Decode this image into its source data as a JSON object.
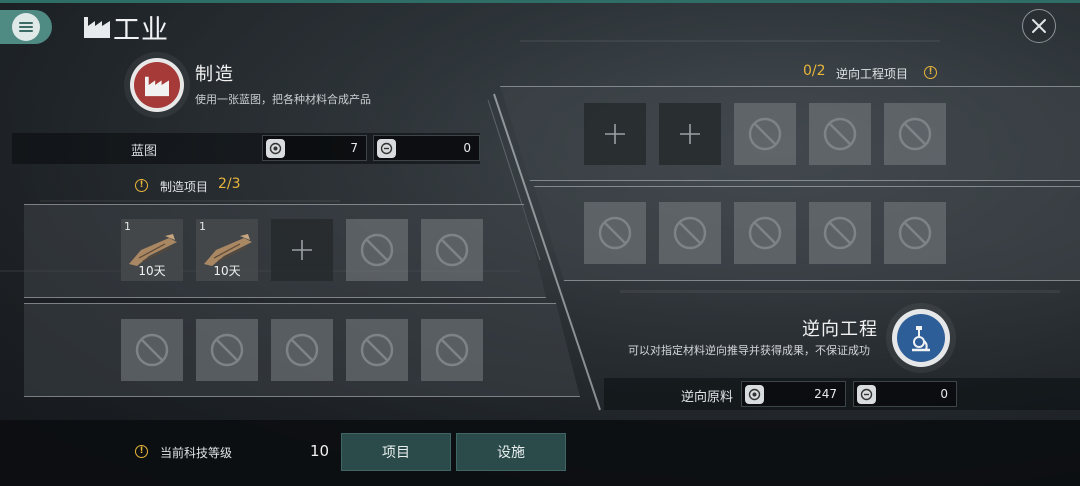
{
  "colors": {
    "accent_teal": "#4f8a83",
    "warning_gold": "#e8b53a",
    "manufacture_red": "#a53a38",
    "reverse_blue": "#2e5e97"
  },
  "header": {
    "title": "工业",
    "title_icon": "factory-icon",
    "menu_icon": "menu-icon",
    "close_icon": "close-icon"
  },
  "manufacture": {
    "title": "制造",
    "description": "使用一张蓝图，把各种材料合成产品",
    "icon": "factory-icon",
    "blueprint": {
      "label": "蓝图",
      "resource_a": {
        "icon": "blueprint-token-icon",
        "value": "7"
      },
      "resource_b": {
        "icon": "blueprint-token-alt-icon",
        "value": "0"
      }
    },
    "projects_label": "制造项目",
    "projects_count": "2/3",
    "slots": [
      {
        "state": "item",
        "qty": "1",
        "duration": "10天"
      },
      {
        "state": "item",
        "qty": "1",
        "duration": "10天"
      },
      {
        "state": "add"
      },
      {
        "state": "locked"
      },
      {
        "state": "locked"
      },
      {
        "state": "locked"
      },
      {
        "state": "locked"
      },
      {
        "state": "locked"
      },
      {
        "state": "locked"
      },
      {
        "state": "locked"
      }
    ]
  },
  "reverse": {
    "projects_count": "0/2",
    "projects_label": "逆向工程项目",
    "title": "逆向工程",
    "description": "可以对指定材料逆向推导并获得成果，不保证成功",
    "icon": "microscope-icon",
    "material": {
      "label": "逆向原料",
      "resource_a": {
        "icon": "material-token-icon",
        "value": "247"
      },
      "resource_b": {
        "icon": "material-token-alt-icon",
        "value": "0"
      }
    },
    "slots": [
      {
        "state": "add"
      },
      {
        "state": "add"
      },
      {
        "state": "locked"
      },
      {
        "state": "locked"
      },
      {
        "state": "locked"
      },
      {
        "state": "locked"
      },
      {
        "state": "locked"
      },
      {
        "state": "locked"
      },
      {
        "state": "locked"
      },
      {
        "state": "locked"
      }
    ]
  },
  "footer": {
    "tech_level_label": "当前科技等级",
    "tech_level_value": "10",
    "tab_projects": "项目",
    "tab_facilities": "设施"
  }
}
